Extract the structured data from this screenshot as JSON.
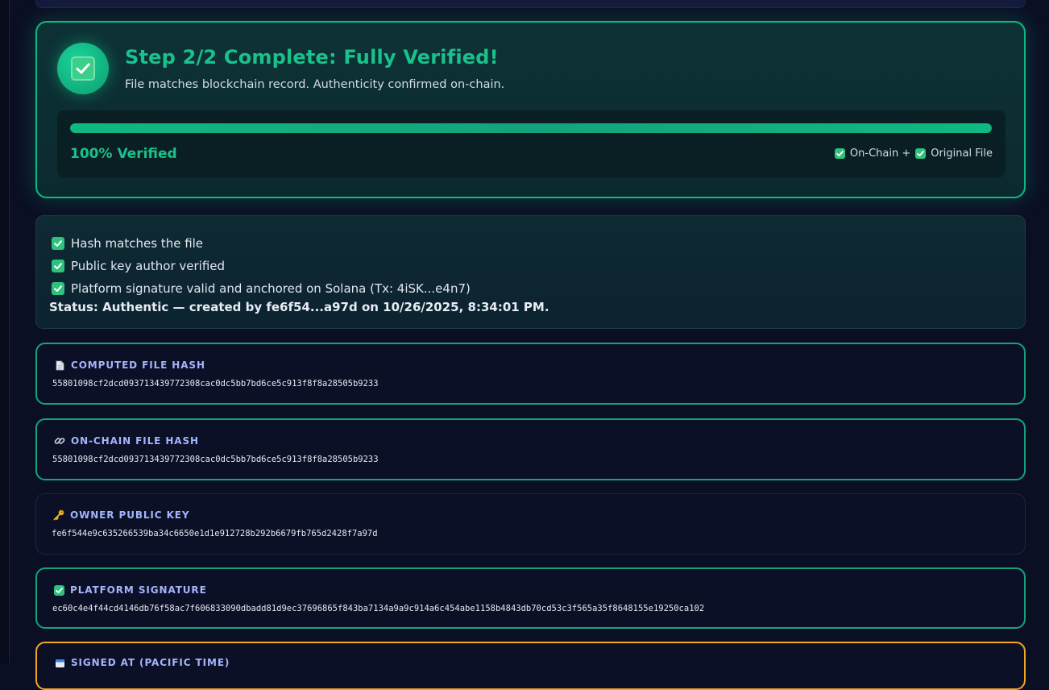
{
  "hero": {
    "title": "Step 2/2 Complete: Fully Verified!",
    "subtitle": "File matches blockchain record. Authenticity confirmed on-chain.",
    "progress_percent": 100,
    "progress_label": "100% Verified",
    "tag_onchain": "On-Chain +",
    "tag_original": "Original File"
  },
  "checks": {
    "items": [
      "Hash matches the file",
      "Public key author verified",
      "Platform signature valid and anchored on Solana (Tx: 4iSK...e4n7)"
    ],
    "status": "Status: Authentic — created by fe6f54...a97d on 10/26/2025, 8:34:01 PM."
  },
  "fields": {
    "computed_hash": {
      "icon": "document-icon",
      "label": "COMPUTED FILE HASH",
      "value": "55801098cf2dcd093713439772308cac0dc5bb7bd6ce5c913f8f8a28505b9233"
    },
    "onchain_hash": {
      "icon": "link-icon",
      "label": "ON-CHAIN FILE HASH",
      "value": "55801098cf2dcd093713439772308cac0dc5bb7bd6ce5c913f8f8a28505b9233"
    },
    "owner_key": {
      "icon": "key-icon",
      "label": "OWNER PUBLIC KEY",
      "value": "fe6f544e9c635266539ba34c6650e1d1e912728b292b6679fb765d2428f7a97d"
    },
    "platform_signature": {
      "icon": "check-icon",
      "label": "PLATFORM SIGNATURE",
      "value": "ec60c4e4f44cd4146db76f58ac7f606833090dbadd81d9ec37696865f843ba7134a9a9c914a6c454abe1158b4843db70cd53c3f565a35f8648155e19250ca102"
    },
    "signed_at": {
      "icon": "calendar-icon",
      "label": "SIGNED AT (PACIFIC TIME)"
    }
  },
  "colors": {
    "accent_green": "#10b981",
    "label_indigo": "#a5b4fc",
    "warning_orange": "#f5a623",
    "background": "#0b0f24"
  }
}
